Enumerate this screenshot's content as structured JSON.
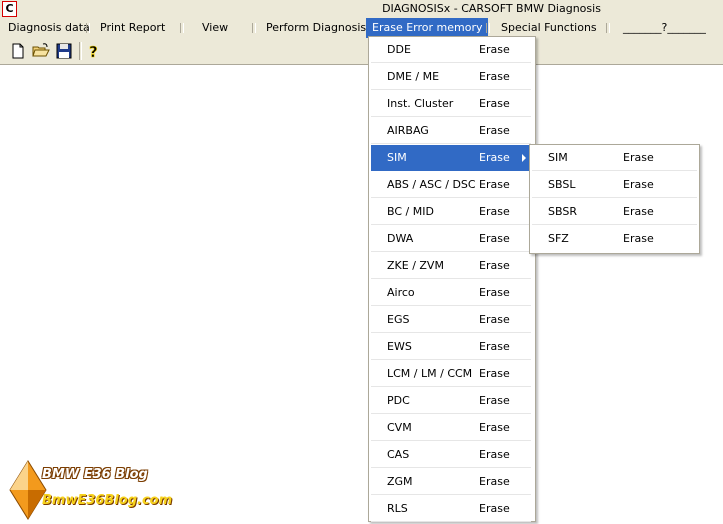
{
  "window": {
    "app_icon": "C",
    "title": "DIAGNOSISx - CARSOFT BMW Diagnosis"
  },
  "menubar": {
    "items": [
      {
        "label": "Diagnosis data"
      },
      {
        "label": "Print Report"
      },
      {
        "label": "View"
      },
      {
        "label": "Perform Diagnosis"
      },
      {
        "label": "Erase Error memory"
      },
      {
        "label": "Special Functions"
      },
      {
        "label": "_______?_______"
      }
    ]
  },
  "toolbar": {
    "icons": [
      "new-document-icon",
      "open-folder-icon",
      "save-disk-icon",
      "help-icon"
    ]
  },
  "erase_menu": {
    "items": [
      {
        "label": "DDE",
        "action": "Erase"
      },
      {
        "label": "DME / ME",
        "action": "Erase"
      },
      {
        "label": "Inst. Cluster",
        "action": "Erase"
      },
      {
        "label": "AIRBAG",
        "action": "Erase"
      },
      {
        "label": "SIM",
        "action": "Erase"
      },
      {
        "label": "ABS / ASC / DSC",
        "action": "Erase"
      },
      {
        "label": "BC / MID",
        "action": "Erase"
      },
      {
        "label": "DWA",
        "action": "Erase"
      },
      {
        "label": "ZKE / ZVM",
        "action": "Erase"
      },
      {
        "label": "Airco",
        "action": "Erase"
      },
      {
        "label": "EGS",
        "action": "Erase"
      },
      {
        "label": "EWS",
        "action": "Erase"
      },
      {
        "label": "LCM / LM / CCM",
        "action": "Erase"
      },
      {
        "label": "PDC",
        "action": "Erase"
      },
      {
        "label": "CVM",
        "action": "Erase"
      },
      {
        "label": "CAS",
        "action": "Erase"
      },
      {
        "label": "ZGM",
        "action": "Erase"
      },
      {
        "label": "RLS",
        "action": "Erase"
      }
    ]
  },
  "sim_submenu": {
    "items": [
      {
        "label": "SIM",
        "action": "Erase"
      },
      {
        "label": "SBSL",
        "action": "Erase"
      },
      {
        "label": "SBSR",
        "action": "Erase"
      },
      {
        "label": "SFZ",
        "action": "Erase"
      }
    ]
  },
  "watermark": {
    "line1": "BMW E36 Blog",
    "line2": "BmwE36Blog.com"
  },
  "colors": {
    "highlight": "#316ac5",
    "menubar_bg": "#ece9d8",
    "workspace_bg": "#ffffff",
    "watermark_orange": "#f39a1d"
  }
}
